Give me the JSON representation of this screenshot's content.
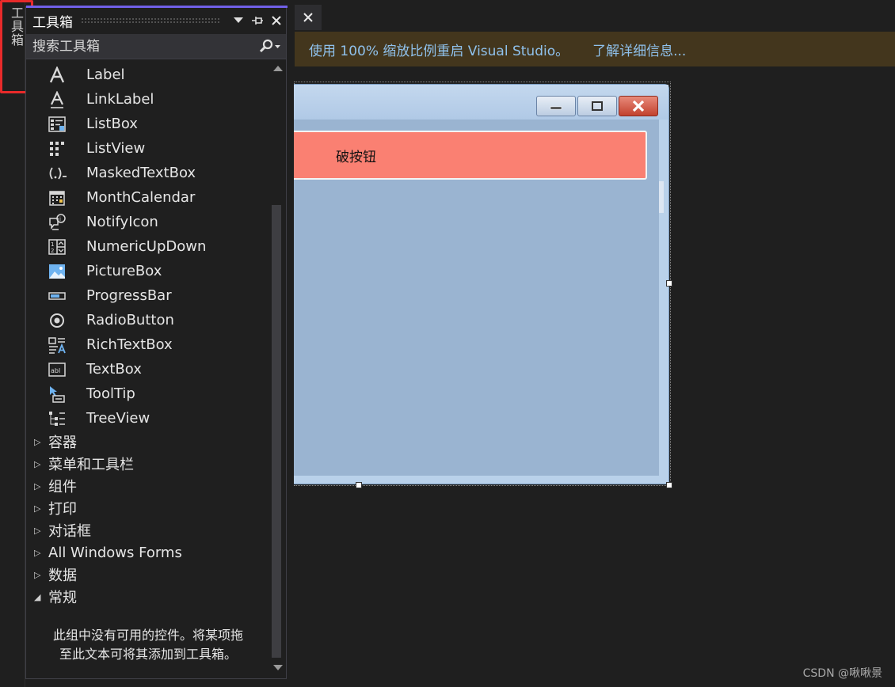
{
  "side_tab": {
    "label": "工具箱"
  },
  "toolbox": {
    "title": "工具箱",
    "search_placeholder": "搜索工具箱",
    "items": [
      {
        "label": "Label",
        "icon": "label-icon"
      },
      {
        "label": "LinkLabel",
        "icon": "linklabel-icon"
      },
      {
        "label": "ListBox",
        "icon": "listbox-icon"
      },
      {
        "label": "ListView",
        "icon": "listview-icon"
      },
      {
        "label": "MaskedTextBox",
        "icon": "maskedtextbox-icon"
      },
      {
        "label": "MonthCalendar",
        "icon": "monthcalendar-icon"
      },
      {
        "label": "NotifyIcon",
        "icon": "notifyicon-icon"
      },
      {
        "label": "NumericUpDown",
        "icon": "numericupdown-icon"
      },
      {
        "label": "PictureBox",
        "icon": "picturebox-icon"
      },
      {
        "label": "ProgressBar",
        "icon": "progressbar-icon"
      },
      {
        "label": "RadioButton",
        "icon": "radiobutton-icon"
      },
      {
        "label": "RichTextBox",
        "icon": "richtextbox-icon"
      },
      {
        "label": "TextBox",
        "icon": "textbox-icon"
      },
      {
        "label": "ToolTip",
        "icon": "tooltip-icon"
      },
      {
        "label": "TreeView",
        "icon": "treeview-icon"
      }
    ],
    "groups": [
      {
        "label": "容器",
        "expanded": false
      },
      {
        "label": "菜单和工具栏",
        "expanded": false
      },
      {
        "label": "组件",
        "expanded": false
      },
      {
        "label": "打印",
        "expanded": false
      },
      {
        "label": "对话框",
        "expanded": false
      },
      {
        "label": "All Windows Forms",
        "expanded": false
      },
      {
        "label": "数据",
        "expanded": false
      },
      {
        "label": "常规",
        "expanded": true
      }
    ],
    "empty_message_line1": "此组中没有可用的控件。将某项拖",
    "empty_message_line2": "至此文本可将其添加到工具箱。"
  },
  "infobar": {
    "message": "使用 100% 缩放比例重启 Visual Studio。",
    "link": "了解详细信息..."
  },
  "designer": {
    "button_text": "破按钮",
    "button_color": "#fa8072",
    "form_color": "#9ab4d1"
  },
  "watermark": "CSDN @啾啾景",
  "colors": {
    "accent": "#7160e8",
    "infobar_bg": "#43361d",
    "infobar_text": "#8fc1ec",
    "highlight_box": "#e82a2a"
  }
}
